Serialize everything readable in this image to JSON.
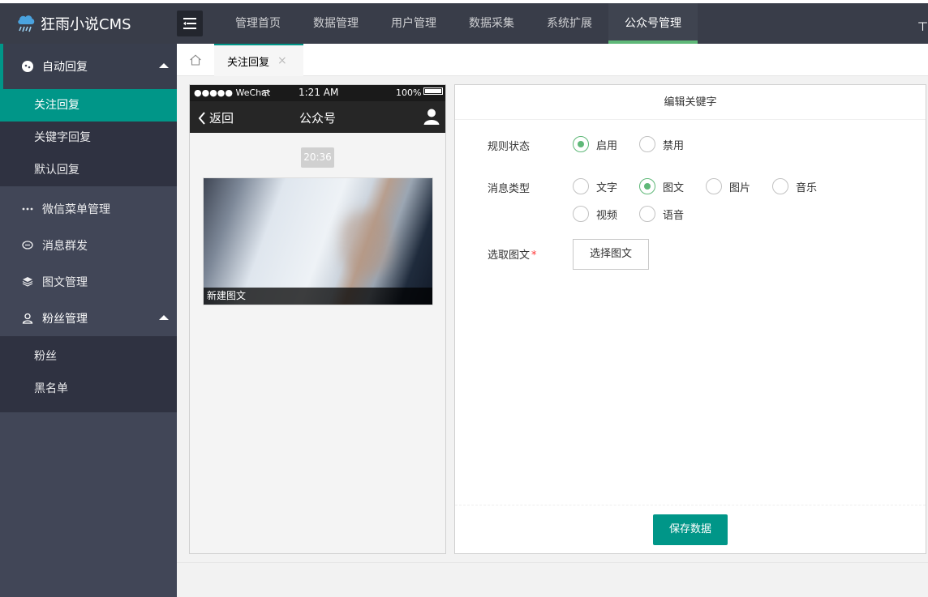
{
  "app": {
    "title": "狂雨小说CMS"
  },
  "topnav": [
    {
      "label": "管理首页"
    },
    {
      "label": "数据管理"
    },
    {
      "label": "用户管理"
    },
    {
      "label": "数据采集"
    },
    {
      "label": "系统扩展"
    },
    {
      "label": "公众号管理",
      "active": true
    }
  ],
  "top_right_glyph": "ㄒ",
  "sidebar": {
    "groups": [
      {
        "label": "自动回复",
        "icon": "wechat-icon",
        "expanded": true,
        "items": [
          {
            "label": "关注回复",
            "active": true
          },
          {
            "label": "关键字回复"
          },
          {
            "label": "默认回复"
          }
        ]
      },
      {
        "label": "微信菜单管理",
        "icon": "dots-icon"
      },
      {
        "label": "消息群发",
        "icon": "message-icon"
      },
      {
        "label": "图文管理",
        "icon": "layers-icon"
      },
      {
        "label": "粉丝管理",
        "icon": "user-icon",
        "expanded": true,
        "items": [
          {
            "label": "粉丝"
          },
          {
            "label": "黑名单"
          }
        ]
      }
    ]
  },
  "tabs": [
    {
      "label": "关注回复",
      "close": "×"
    }
  ],
  "phone": {
    "carrier": "●●●●● WeChat",
    "time": "1:21 AM",
    "battery": "100%",
    "back": "返回",
    "title": "公众号",
    "msg_time": "20:36",
    "news_caption": "新建图文"
  },
  "panel": {
    "title": "编辑关键字",
    "rule_status_label": "规则状态",
    "rule_status_options": [
      "启用",
      "禁用"
    ],
    "rule_status_selected": "启用",
    "msg_type_label": "消息类型",
    "msg_type_options": [
      "文字",
      "图文",
      "图片",
      "音乐",
      "视频",
      "语音"
    ],
    "msg_type_selected": "图文",
    "pick_news_label": "选取图文",
    "pick_news_required": "*",
    "pick_news_button": "选择图文",
    "save_button": "保存数据"
  },
  "colors": {
    "primary": "#009688",
    "header": "#393d49",
    "sidebar": "#414657",
    "accent": "#5fb878"
  }
}
